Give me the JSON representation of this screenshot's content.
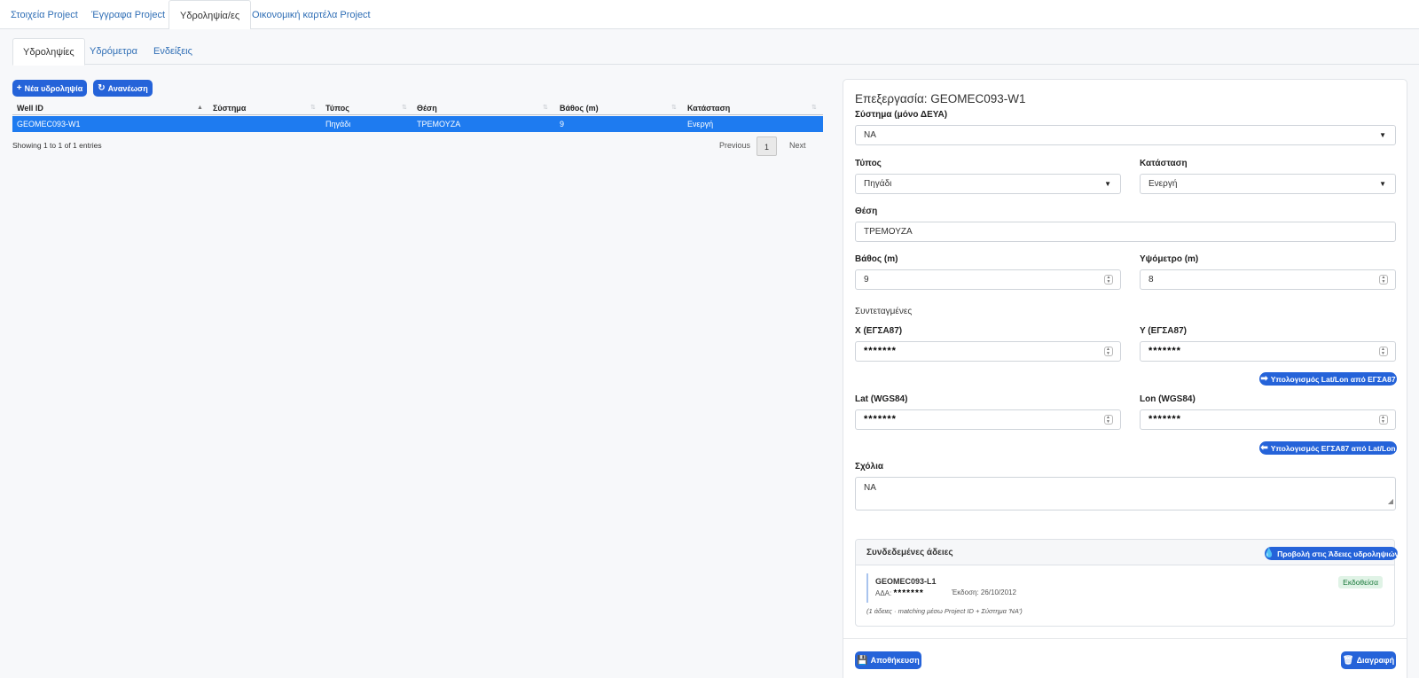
{
  "top_tabs": [
    "Στοιχεία Project",
    "Έγγραφα Project",
    "Υδροληψία/ες",
    "Οικονομική καρτέλα Project"
  ],
  "sub_tabs": [
    "Υδροληψίες",
    "Υδρόμετρα",
    "Ενδείξεις"
  ],
  "toolbar": {
    "new_label": "Νέα υδροληψία",
    "refresh_label": "Ανανέωση"
  },
  "table": {
    "columns": [
      "Well ID",
      "Σύστημα",
      "Τύπος",
      "Θέση",
      "Βάθος (m)",
      "Κατάσταση"
    ],
    "rows": [
      {
        "well_id": "GEOMEC093-W1",
        "system": "",
        "type": "Πηγάδι",
        "location": "ΤΡΕΜΟΥΖΑ",
        "depth": "9",
        "status": "Ενεργή"
      }
    ],
    "info": "Showing 1 to 1 of 1 entries",
    "prev": "Previous",
    "page": "1",
    "next": "Next"
  },
  "form": {
    "title": "Επεξεργασία: GEOMEC093-W1",
    "system_label": "Σύστημα (μόνο ΔΕΥΑ)",
    "system_value": "NA",
    "type_label": "Τύπος",
    "type_value": "Πηγάδι",
    "status_label": "Κατάσταση",
    "status_value": "Ενεργή",
    "location_label": "Θέση",
    "location_value": "ΤΡΕΜΟΥΖΑ",
    "depth_label": "Βάθος (m)",
    "depth_value": "9",
    "altitude_label": "Υψόμετρο (m)",
    "altitude_value": "8",
    "coords_heading": "Συντεταγμένες",
    "x_label": "X (ΕΓΣΑ87)",
    "x_value": "*******",
    "y_label": "Y (ΕΓΣΑ87)",
    "y_value": "*******",
    "calc_latlon_label": "Υπολογισμός Lat/Lon από ΕΓΣΑ87",
    "lat_label": "Lat (WGS84)",
    "lat_value": "*******",
    "lon_label": "Lon (WGS84)",
    "lon_value": "*******",
    "calc_egsa_label": "Υπολογισμός ΕΓΣΑ87 από Lat/Lon",
    "comments_label": "Σχόλια",
    "comments_value": "NA",
    "linked_title": "Συνδεδεμένες άδειες",
    "linked_button": "Προβολή στις Άδειες υδροληψιών",
    "permit_id": "GEOMEC093-L1",
    "permit_ada_label": "ΑΔΑ:",
    "permit_ada_value": "*******",
    "permit_issue": "Έκδοση: 26/10/2012",
    "permit_status": "Εκδοθείσα",
    "permit_note": "(1 άδειες · matching μέσω Project ID + Σύστημα 'NA')",
    "save_label": "Αποθήκευση",
    "delete_label": "Διαγραφή"
  }
}
